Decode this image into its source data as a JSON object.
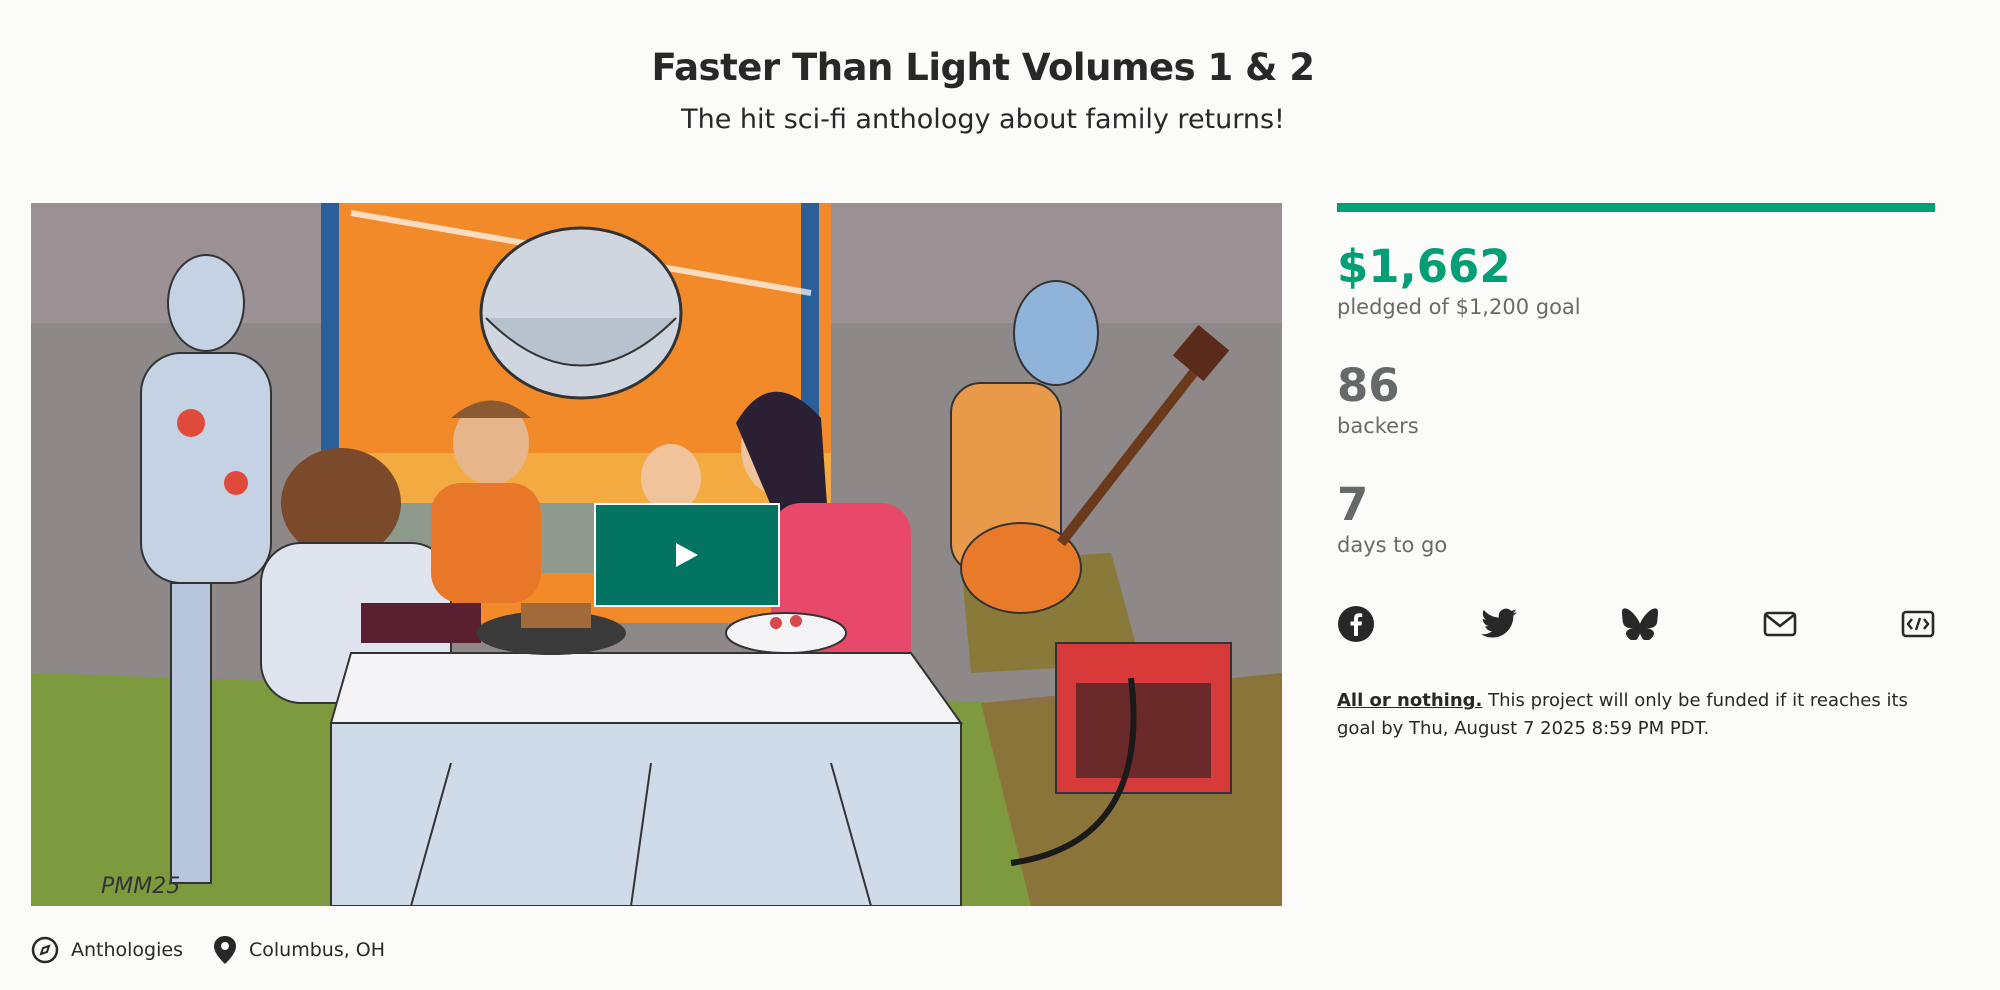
{
  "project": {
    "title": "Faster Than Light Volumes 1 & 2",
    "blurb": "The hit sci-fi anthology about family returns!"
  },
  "video": {
    "play_label": "Play"
  },
  "meta": {
    "category": "Anthologies",
    "location": "Columbus, OH",
    "category_icon": "compass-icon",
    "location_icon": "map-pin-icon"
  },
  "stats": {
    "funded_fraction": 1.0,
    "pledged": "$1,662",
    "pledged_label": "pledged of $1,200 goal",
    "backers": "86",
    "backers_label": "backers",
    "days": "7",
    "days_label": "days to go"
  },
  "share": [
    {
      "name": "facebook-icon"
    },
    {
      "name": "twitter-icon"
    },
    {
      "name": "bluesky-icon"
    },
    {
      "name": "email-icon"
    },
    {
      "name": "embed-icon"
    }
  ],
  "funding": {
    "link_text": "All or nothing.",
    "text": "This project will only be funded if it reaches its goal by Thu, August 7 2025 8:59 PM PDT."
  },
  "colors": {
    "accent": "#029e74",
    "play_button": "#037362"
  },
  "artwork_signature": "PMM25"
}
